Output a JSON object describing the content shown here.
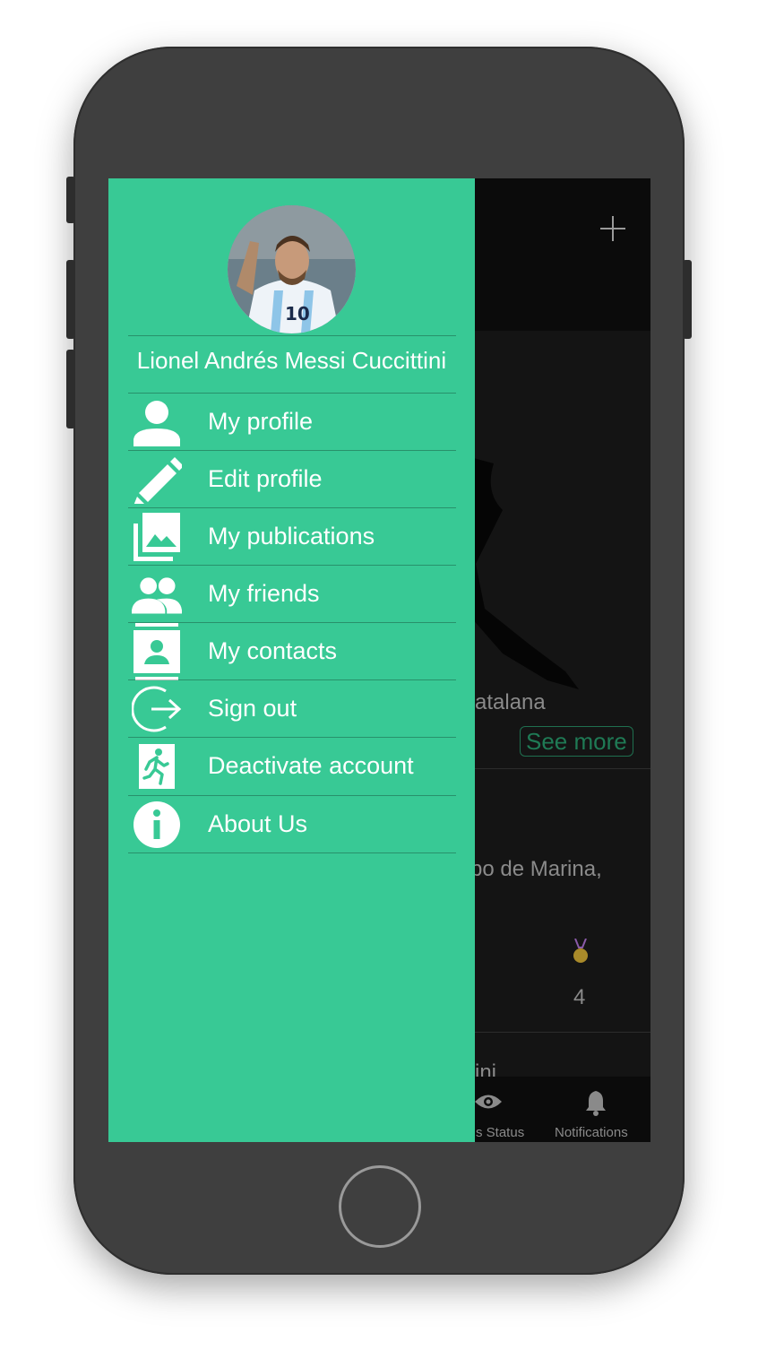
{
  "colors": {
    "drawer_bg": "#38c995",
    "accent": "#1f7a55",
    "phone_body": "#3f3f3f"
  },
  "drawer": {
    "user_name": "Lionel Andrés Messi Cuccittini",
    "menu": [
      {
        "label": "My profile",
        "icon": "person-icon"
      },
      {
        "label": "Edit profile",
        "icon": "pencil-icon"
      },
      {
        "label": "My publications",
        "icon": "gallery-icon"
      },
      {
        "label": "My friends",
        "icon": "group-icon"
      },
      {
        "label": "My contacts",
        "icon": "contact-card-icon"
      },
      {
        "label": "Sign out",
        "icon": "sign-out-icon"
      },
      {
        "label": "Deactivate account",
        "icon": "exit-run-icon"
      },
      {
        "label": "About Us",
        "icon": "info-icon"
      }
    ]
  },
  "background": {
    "text_1": "atalana",
    "see_more": "See more",
    "text_2": "po de Marina,",
    "medal_count": "4",
    "text_3": "ini",
    "tabs": [
      {
        "label": "s Status",
        "icon": "eye-icon"
      },
      {
        "label": "Notifications",
        "icon": "bell-icon"
      }
    ]
  }
}
